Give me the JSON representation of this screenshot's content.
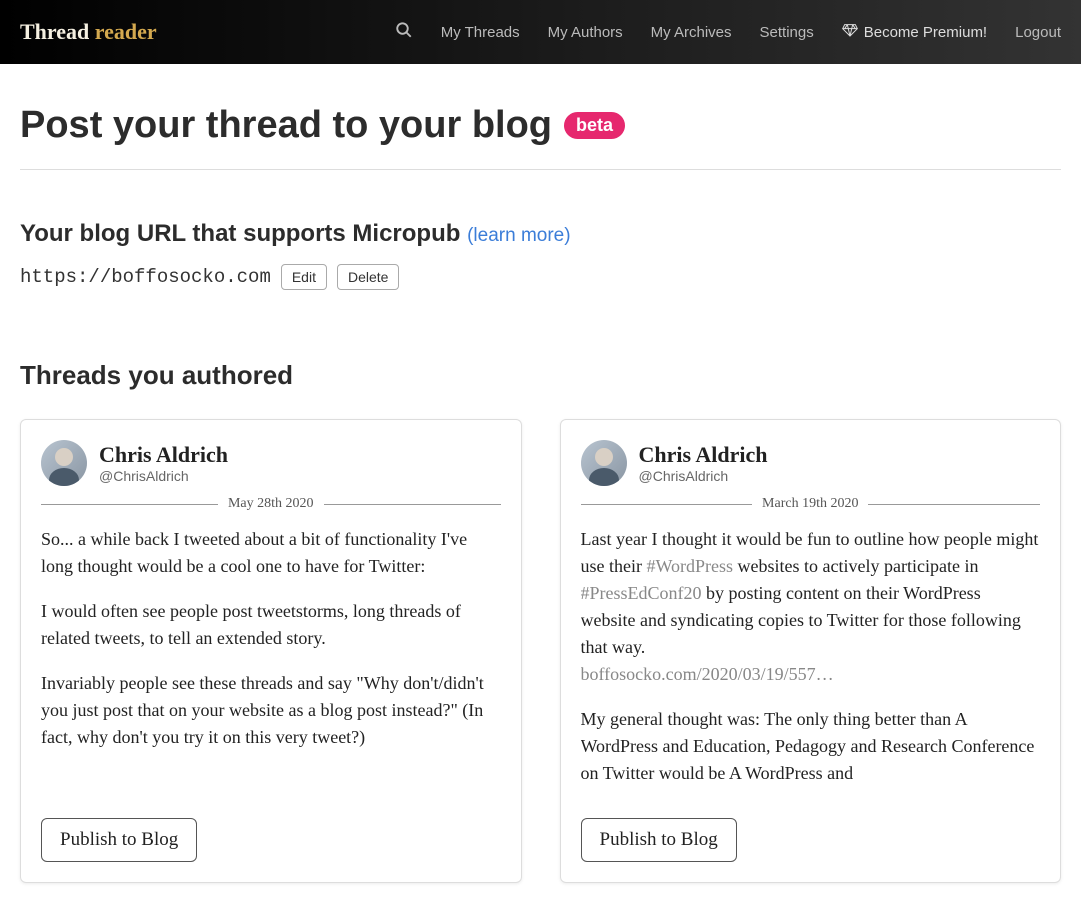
{
  "brand": {
    "word1": "Thread",
    "word2": "reader"
  },
  "nav": {
    "my_threads": "My Threads",
    "my_authors": "My Authors",
    "my_archives": "My Archives",
    "settings": "Settings",
    "premium": "Become Premium!",
    "logout": "Logout"
  },
  "page": {
    "title": "Post your thread to your blog",
    "beta": "beta"
  },
  "blog_section": {
    "heading": "Your blog URL that supports Micropub",
    "learn_more": "(learn more)",
    "url": "https://boffosocko.com",
    "edit": "Edit",
    "delete": "Delete"
  },
  "threads_heading": "Threads you authored",
  "publish_label": "Publish to Blog",
  "threads": [
    {
      "author_name": "Chris Aldrich",
      "author_handle": "@ChrisAldrich",
      "date": "May 28th 2020",
      "p1": "So... a while back I tweeted about a bit of functionality I've long thought would be a cool one to have for Twitter:",
      "p2": "I would often see people post tweetstorms, long threads of related tweets, to tell an extended story.",
      "p3": "Invariably people see these threads and say \"Why don't/didn't you just post that on your website as a blog post instead?\" (In fact, why don't you try it on this very tweet?)"
    },
    {
      "author_name": "Chris Aldrich",
      "author_handle": "@ChrisAldrich",
      "date": "March 19th 2020",
      "intro_a": "Last year I thought it would be fun to outline how people might use their ",
      "hashtag1": "#WordPress",
      "intro_b": " websites to actively participate in ",
      "hashtag2": "#PressEdConf20",
      "intro_c": " by posting content on their WordPress website and syndicating copies to Twitter for those following that way.",
      "shortlink": "boffosocko.com/2020/03/19/557…",
      "p2": "My general thought was: The only thing better than A WordPress and Education, Pedagogy and Research Conference on Twitter would be A WordPress and"
    }
  ]
}
